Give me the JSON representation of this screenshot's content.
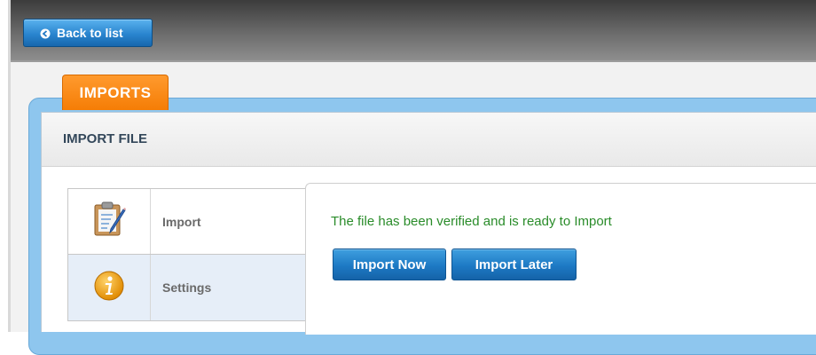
{
  "toolbar": {
    "back_label": "Back to list",
    "back_icon": "arrow-left-circle-icon"
  },
  "section": {
    "tab_label": "IMPORTS",
    "panel_title": "IMPORT FILE"
  },
  "steps": [
    {
      "label": "Import",
      "icon": "clipboard-pencil-icon"
    },
    {
      "label": "Settings",
      "icon": "info-icon"
    }
  ],
  "main": {
    "message": "The file has been verified and is ready to Import",
    "import_now_label": "Import Now",
    "import_later_label": "Import Later"
  },
  "colors": {
    "tab_orange": "#f57d05",
    "button_blue": "#1d79c4",
    "success_green": "#2a8c2a",
    "panel_blue": "#8ec6ee"
  }
}
